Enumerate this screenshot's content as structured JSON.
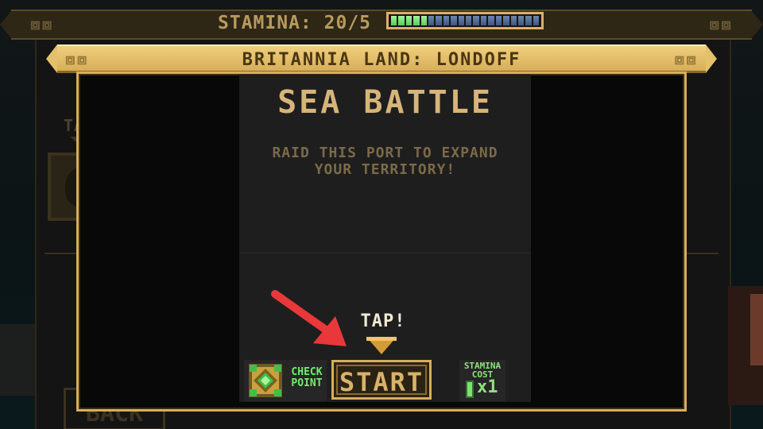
{
  "hud": {
    "stamina_label": "STAMINA: 20/5",
    "stamina_meter": {
      "filled_segments": 5,
      "total_segments": 20
    }
  },
  "location": {
    "title": "BRITANNIA LAND: LONDOFF"
  },
  "background": {
    "tap_text": "TAP!",
    "back_button_label": "BACK"
  },
  "mission": {
    "title": "SEA BATTLE",
    "description": "RAID THIS PORT TO EXPAND\nYOUR TERRITORY!"
  },
  "prompt": {
    "tap_text": "TAP!"
  },
  "controls": {
    "checkpoint_label": "CHECK\nPOINT",
    "start_label": "START",
    "stamina_cost_label": "STAMINA\nCOST",
    "stamina_cost_value": "x1"
  },
  "colors": {
    "gold": "#d7ae5a",
    "start_text": "#d9b26a",
    "stamina_green": "#4fcf54",
    "stamina_blue": "#3d5580",
    "highlight_arrow": "#e8383a"
  },
  "icons": {
    "checkpoint": "checkpoint-emblem-icon",
    "tap_pointer": "down-triangle-icon",
    "highlight": "red-arrow-icon",
    "stamina_cost": "battery-icon"
  }
}
